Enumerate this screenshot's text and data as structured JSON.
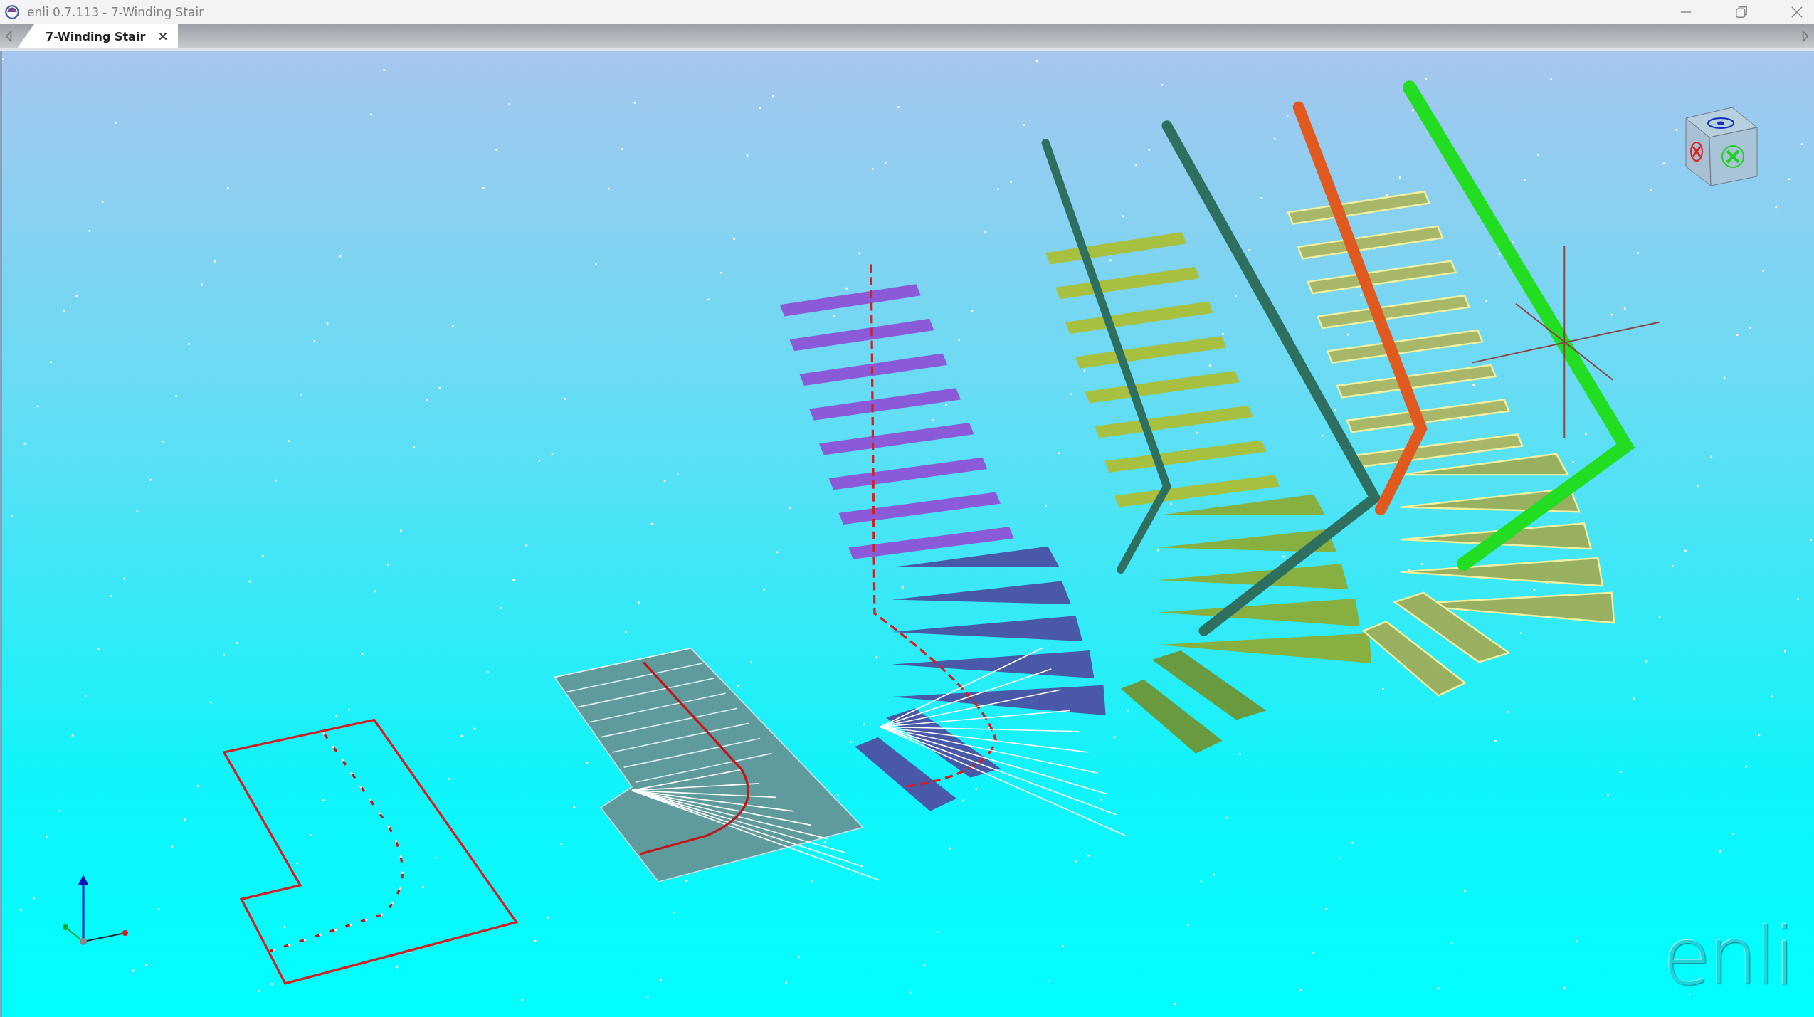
{
  "window": {
    "title": "enli 0.7.113 - 7-Winding Stair"
  },
  "tabs": [
    {
      "label": "7-Winding Stair",
      "selected": true
    }
  ],
  "viewport": {
    "logo": "enli"
  }
}
